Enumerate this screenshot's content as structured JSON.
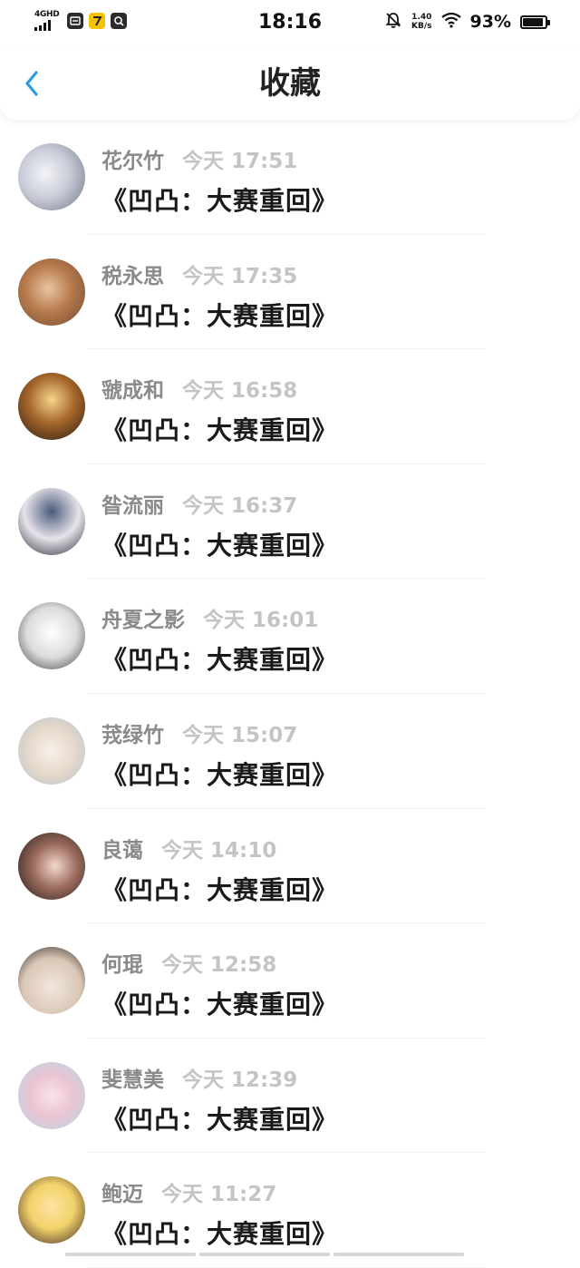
{
  "status_bar": {
    "network": "4GHD",
    "time": "18:16",
    "speed_value": "1.40",
    "speed_unit": "KB/s",
    "battery": "93%",
    "battery_level": 0.93,
    "icons": [
      "signal-icon",
      "app-notification-icon",
      "mute-bell-icon",
      "wifi-icon",
      "battery-icon"
    ]
  },
  "nav": {
    "title": "收藏",
    "back_icon": "chevron-left-icon",
    "accent": "#2a9be6"
  },
  "items": [
    {
      "name": "花尔竹",
      "time": "今天 17:51",
      "title": "《凹凸：大赛重回》"
    },
    {
      "name": "税永思",
      "time": "今天 17:35",
      "title": "《凹凸：大赛重回》"
    },
    {
      "name": "虢成和",
      "time": "今天 16:58",
      "title": "《凹凸：大赛重回》"
    },
    {
      "name": "昝流丽",
      "time": "今天 16:37",
      "title": "《凹凸：大赛重回》"
    },
    {
      "name": "舟夏之影",
      "time": "今天 16:01",
      "title": "《凹凸：大赛重回》"
    },
    {
      "name": "茙绿竹",
      "time": "今天 15:07",
      "title": "《凹凸：大赛重回》"
    },
    {
      "name": "良蔼",
      "time": "今天 14:10",
      "title": "《凹凸：大赛重回》"
    },
    {
      "name": "何琨",
      "time": "今天 12:58",
      "title": "《凹凸：大赛重回》"
    },
    {
      "name": "斐慧美",
      "time": "今天 12:39",
      "title": "《凹凸：大赛重回》"
    },
    {
      "name": "鲍迈",
      "time": "今天 11:27",
      "title": "《凹凸：大赛重回》"
    }
  ]
}
